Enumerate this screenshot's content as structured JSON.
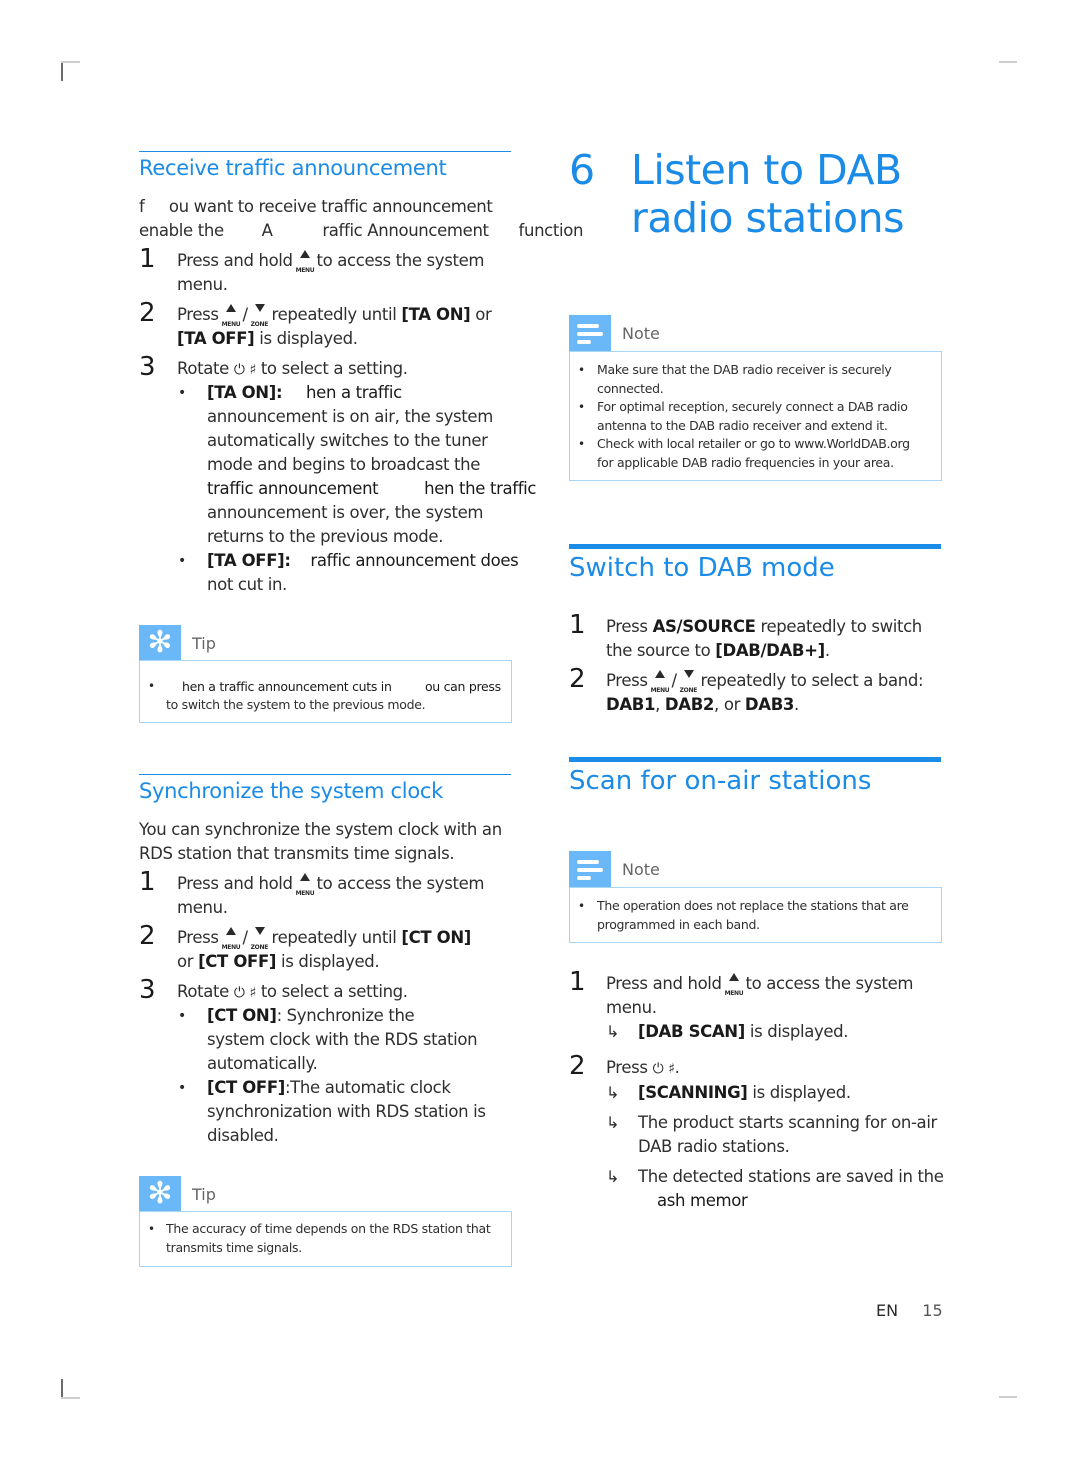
{
  "page": {
    "language_code": "EN",
    "page_number": "15"
  },
  "left": {
    "receive_ta": {
      "heading": "Receive traffic announcement",
      "intro_line1": "f     ou want to receive traffic announcement",
      "intro_line2_a": "enable the",
      "intro_line2_b": "A",
      "intro_line2_c": "raffic Announcement",
      "intro_line2_d": "function",
      "steps": [
        {
          "num": "1",
          "line1_pre": "Press and hold",
          "line1_post": "to access the system",
          "line2": "menu."
        },
        {
          "num": "2",
          "line1_pre": "Press",
          "line1_sep": "/",
          "line1_post": "repeatedly until",
          "line1_bold": "[TA ON]",
          "line1_tail": "or",
          "line2_bold": "[TA OFF]",
          "line2": "is displayed."
        },
        {
          "num": "3",
          "line1_pre": "Rotate",
          "line1_post": "to select a setting."
        }
      ],
      "options": [
        {
          "label": "[TA ON]:",
          "lines": [
            "hen a traffic",
            "announcement is on air, the system",
            "automatically switches to the tuner",
            "mode and begins to broadcast the",
            "traffic announcement",
            "hen the traffic",
            "announcement is over, the system",
            "returns to the previous mode."
          ]
        },
        {
          "label": "[TA OFF]:",
          "lines": [
            "raffic announcement does",
            "not cut in."
          ]
        }
      ],
      "tip": {
        "label": "Tip",
        "line1_a": "hen a traffic announcement cuts in",
        "line1_b": "ou can press",
        "line2": "to switch the system to the previous mode."
      }
    },
    "sync_clock": {
      "heading": "Synchronize the system clock",
      "intro_line1": "You can synchronize the system clock with an",
      "intro_line2": "RDS station that transmits time signals.",
      "steps": [
        {
          "num": "1",
          "line1_pre": "Press and hold",
          "line1_post": "to access the system",
          "line2": "menu."
        },
        {
          "num": "2",
          "line1_pre": "Press",
          "line1_sep": "/",
          "line1_post": "repeatedly until",
          "line1_bold": "[CT ON]",
          "line2_pre": "or",
          "line2_bold": "[CT OFF]",
          "line2": "is displayed."
        },
        {
          "num": "3",
          "line1_pre": "Rotate",
          "line1_post": "to select a setting."
        }
      ],
      "options": [
        {
          "label": "[CT ON]",
          "lines": [
            ": Synchronize the",
            "system clock with the RDS station",
            "automatically."
          ]
        },
        {
          "label": "[CT OFF]",
          "lines": [
            ":The automatic clock",
            "synchronization with RDS station is",
            "disabled."
          ]
        }
      ],
      "tip": {
        "label": "Tip",
        "line1": "The accuracy of time depends on the RDS station that",
        "line2": "transmits time signals."
      }
    }
  },
  "right": {
    "chapter": {
      "number": "6",
      "title_line1": "Listen to DAB",
      "title_line2": "radio stations"
    },
    "note1": {
      "label": "Note",
      "items": [
        [
          "Make sure that the DAB radio receiver is securely",
          "connected."
        ],
        [
          "For optimal reception, securely connect a DAB radio",
          "antenna to the DAB radio receiver and extend it."
        ],
        [
          "Check with local retailer or go to www.WorldDAB.org",
          "for applicable DAB radio frequencies in your area."
        ]
      ]
    },
    "switch_dab": {
      "heading": "Switch to DAB mode",
      "steps": [
        {
          "num": "1",
          "line1_pre": "Press",
          "line1_bold": "AS/SOURCE",
          "line1_post": "repeatedly to switch",
          "line2_pre": "the source to",
          "line2_bold": "[DAB/DAB+]",
          "line2_post": "."
        },
        {
          "num": "2",
          "line1_pre": "Press",
          "line1_sep": "/",
          "line1_post": "repeatedly to select a band:",
          "bands": [
            "DAB1",
            "DAB2",
            "DAB3"
          ],
          "sep1": ", ",
          "sep2": ", or ",
          "end": "."
        }
      ]
    },
    "scan": {
      "heading": "Scan for on-air stations",
      "note": {
        "label": "Note",
        "line1": "The operation does not replace the stations that are",
        "line2": "programmed in each band."
      },
      "steps": [
        {
          "num": "1",
          "line1_pre": "Press and hold",
          "line1_post": "to access the system",
          "line2": "menu.",
          "results": [
            {
              "bold": "[DAB SCAN]",
              "text": "is displayed."
            }
          ]
        },
        {
          "num": "2",
          "line1_pre": "Press",
          "line1_post": ".",
          "results": [
            {
              "bold": "[SCANNING]",
              "text": "is displayed."
            },
            {
              "text": "The product starts scanning for on-air",
              "text2": "DAB radio stations."
            },
            {
              "text": "The detected stations are saved in the",
              "text2_bold": "ash memor"
            }
          ]
        }
      ]
    }
  },
  "icons": {
    "menu_key_label": "MENU",
    "zone_key_label": "ZONE",
    "power_glyph": "⓪",
    "mute_glyph": "🔇",
    "result_arrow": "↳",
    "bullet": "•",
    "tip_glyph": "✻"
  }
}
